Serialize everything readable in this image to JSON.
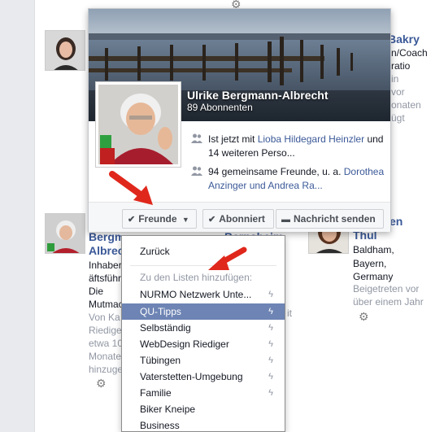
{
  "hovercard": {
    "name": "Ulrike Bergmann-Albrecht",
    "subscribers": "89 Abonnenten",
    "now_with_prefix": "Ist jetzt mit ",
    "now_with_link": "Lioba Hildegard Heinzler",
    "now_with_suffix": " und 14 weiteren Perso...",
    "mutual_prefix": "94 gemeinsame Freunde, u. a. ",
    "mutual_link": "Dorothea Anzinger und Andrea Ra...",
    "buttons": {
      "friends": "Freunde",
      "subscribed": "Abonniert",
      "message": "Nachricht senden"
    }
  },
  "dropdown": {
    "back": "Zurück",
    "hint": "Zu den Listen hinzufügen:",
    "items": [
      {
        "label": "NURMO Netzwerk Unte...",
        "smart": true,
        "selected": false
      },
      {
        "label": "QU-Tipps",
        "smart": true,
        "selected": true
      },
      {
        "label": "Selbständig",
        "smart": true,
        "selected": false
      },
      {
        "label": "WebDesign Riediger",
        "smart": true,
        "selected": false
      },
      {
        "label": "Tübingen",
        "smart": true,
        "selected": false
      },
      {
        "label": "Vaterstetten-Umgebung",
        "smart": true,
        "selected": false
      },
      {
        "label": "Familie",
        "smart": true,
        "selected": false
      },
      {
        "label": "Biker Kneipe",
        "smart": false,
        "selected": false
      },
      {
        "label": "Business",
        "smart": false,
        "selected": false
      }
    ]
  },
  "background": {
    "top_right_name": "Bakry",
    "top_right_lines": [
      "n/Coach",
      "ratio",
      "in",
      "vor",
      "onaten",
      "ügt"
    ],
    "left_name_1": "Bergma",
    "left_name_2": "Albrec",
    "left_lines_dark": [
      "Inhaber",
      "äftsführ",
      "Die",
      "Mutmac"
    ],
    "left_lines_grey": [
      "Von Ka",
      "Riedige",
      "etwa 10",
      "Monate",
      "hinzuge"
    ],
    "mid_name": "Bernsbeim",
    "mid_line": "it",
    "right_name_1": "en",
    "right_name_2": "Thul",
    "right_lines_dark": [
      "Baldham,",
      "Bayern,",
      "Germany"
    ],
    "right_lines_grey": [
      "Beigetreten vor",
      "über einem Jahr"
    ]
  },
  "icons": {
    "gear": "gear-icon",
    "friends": "friends-icon",
    "check": "check-icon",
    "message": "message-icon",
    "bolt": "smart-list-icon",
    "arrow": "red-pointer-arrow"
  },
  "colors": {
    "link": "#3b5998",
    "selected": "#6d84b4",
    "arrow": "#e0271c"
  }
}
